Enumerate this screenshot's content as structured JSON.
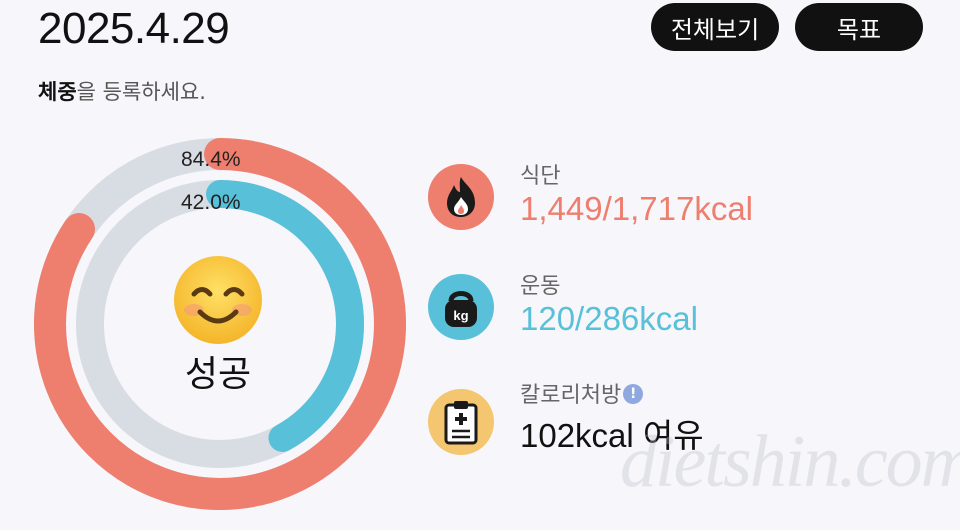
{
  "header": {
    "date": "2025.4.29",
    "view_all_label": "전체보기",
    "goal_label": "목표"
  },
  "weight_prompt": {
    "bold": "체중",
    "rest": "을 등록하세요."
  },
  "ring": {
    "outer_percent_label": "84.4%",
    "inner_percent_label": "42.0%",
    "outer_fraction": 0.844,
    "inner_fraction": 0.42,
    "outer_color": "#ee7e6d",
    "inner_color": "#58c0d8",
    "track_color": "#d8dde3",
    "face_icon": "smiling-face-icon",
    "status": "성공"
  },
  "stats": {
    "diet": {
      "label": "식단",
      "value": "1,449/1,717kcal",
      "icon": "flame-icon",
      "color": "#ee7e6d"
    },
    "exercise": {
      "label": "운동",
      "value": "120/286kcal",
      "icon": "kettlebell-icon",
      "color": "#58c0d8"
    },
    "prescription": {
      "label": "칼로리처방",
      "value": "102kcal 여유",
      "icon": "clipboard-icon",
      "color": "#f4c66f",
      "info_icon": "info-icon",
      "info_glyph": "!"
    }
  },
  "watermark": "dietshin.com"
}
